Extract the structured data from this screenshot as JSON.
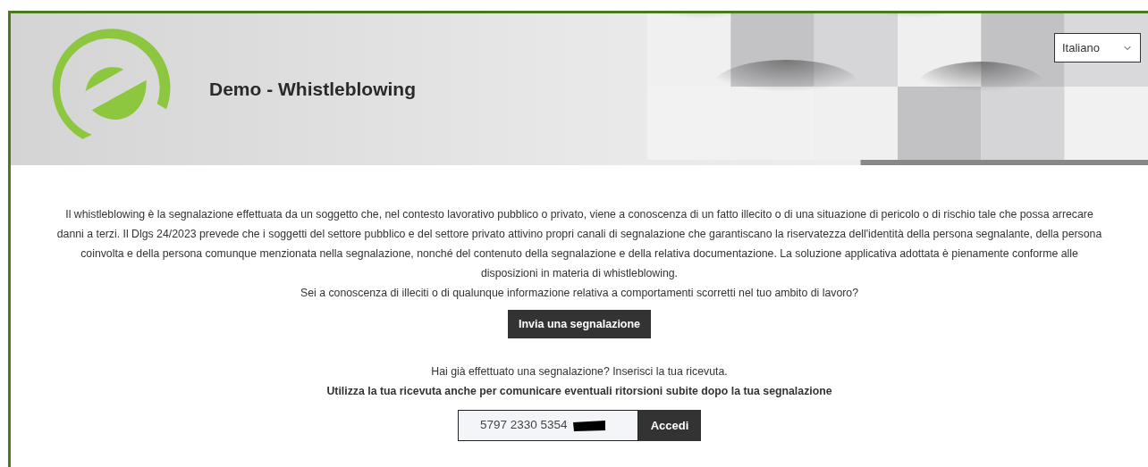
{
  "header": {
    "title": "Demo - Whistleblowing",
    "language_select": {
      "value": "Italiano"
    }
  },
  "intro": {
    "paragraph": "Il whistleblowing è la segnalazione effettuata da un soggetto che, nel contesto lavorativo pubblico o privato, viene a conoscenza di un fatto illecito o di una situazione di pericolo o di rischio tale che possa arrecare danni a terzi. Il Dlgs 24/2023 prevede che i soggetti del settore pubblico e del settore privato attivino propri canali di segnalazione che garantiscano la riservatezza dell'identità della persona segnalante, della persona coinvolta e della persona comunque menzionata nella segnalazione, nonché del contenuto della segnalazione e della relativa documentazione. La soluzione applicativa adottata è pienamente conforme alle disposizioni in materia di whistleblowing.",
    "question": "Sei a conoscenza di illeciti o di qualunque informazione relativa a comportamenti scorretti nel tuo ambito di lavoro?",
    "button": "Invia una segnalazione"
  },
  "receipt": {
    "prompt": "Hai già effettuato una segnalazione? Inserisci la tua ricevuta.",
    "note": "Utilizza la tua ricevuta anche per comunicare eventuali ritorsioni subite dopo la tua segnalazione",
    "field": {
      "value": "5797 2330 5354",
      "redacted": true
    },
    "button": "Accedi"
  }
}
